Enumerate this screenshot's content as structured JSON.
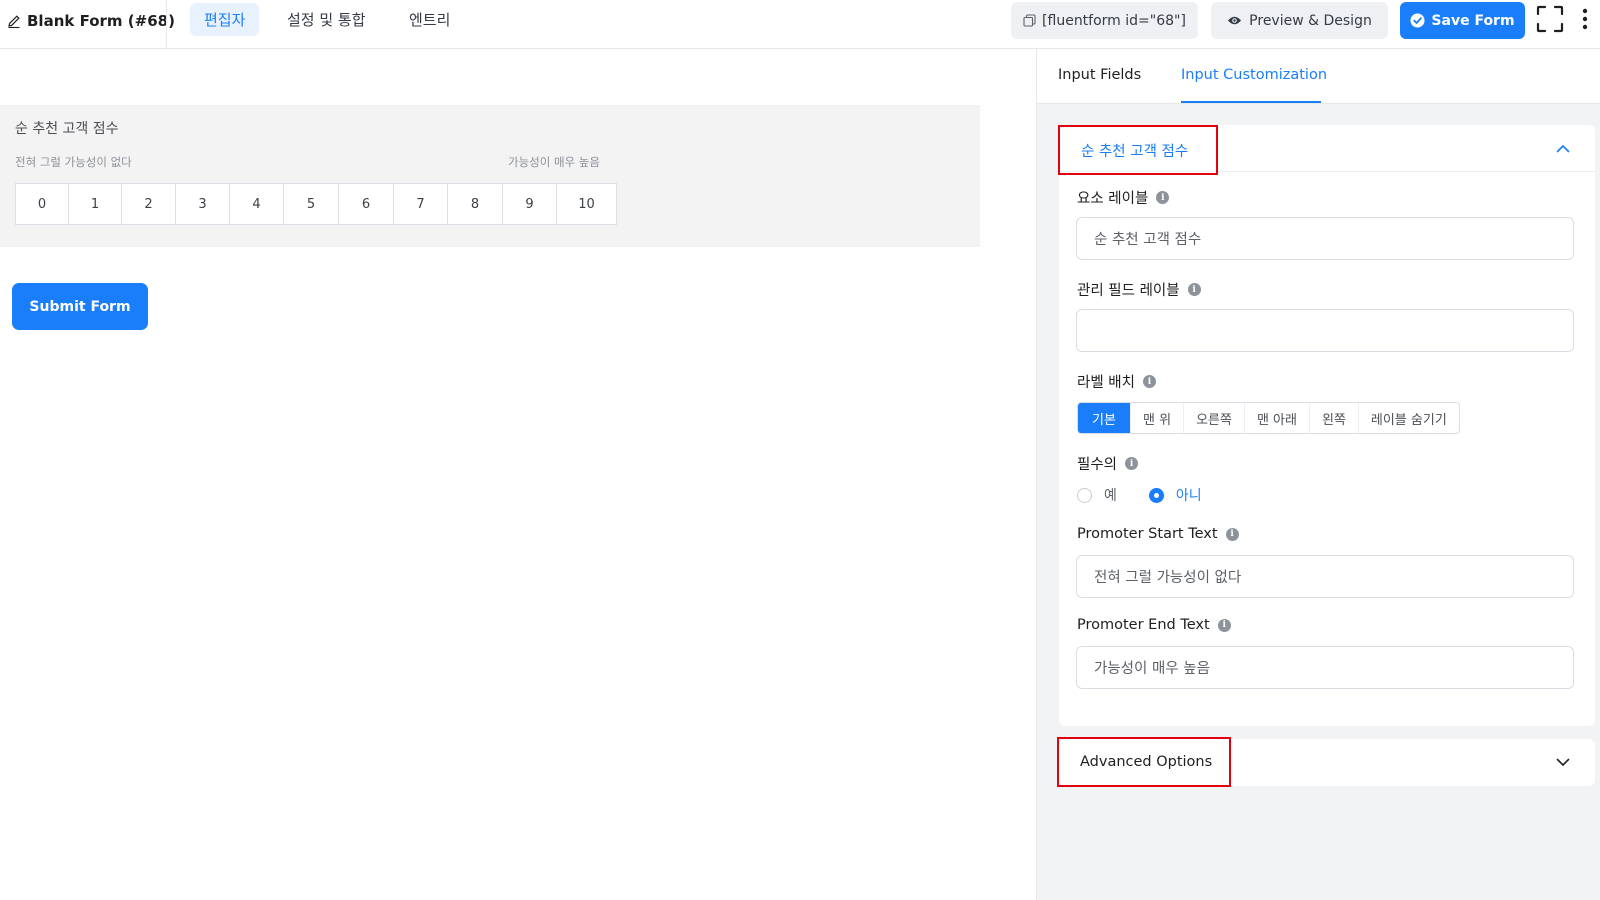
{
  "header": {
    "form_title": "Blank Form (#68)",
    "tabs": [
      {
        "label": "편집자",
        "active": true
      },
      {
        "label": "설정 및 통합",
        "active": false
      },
      {
        "label": "엔트리",
        "active": false
      }
    ],
    "shortcode_label": "[fluentform id=\"68\"]",
    "preview_label": "Preview & Design",
    "save_label": "Save Form"
  },
  "canvas": {
    "field_label": "순 추천 고객 점수",
    "start_text": "전혀 그럴 가능성이 없다",
    "end_text": "가능성이 매우 높음",
    "scale": [
      "0",
      "1",
      "2",
      "3",
      "4",
      "5",
      "6",
      "7",
      "8",
      "9",
      "10"
    ],
    "submit_label": "Submit Form"
  },
  "panel": {
    "tabs": [
      {
        "label": "Input Fields",
        "active": false
      },
      {
        "label": "Input Customization",
        "active": true
      }
    ],
    "section_title": "순 추천 고객 점수",
    "element_label": {
      "label": "요소 레이블",
      "value": "순 추천 고객 점수"
    },
    "admin_label": {
      "label": "관리 필드 레이블",
      "value": ""
    },
    "label_placement": {
      "label": "라벨 배치",
      "options": [
        "기본",
        "맨 위",
        "오른쪽",
        "맨 아래",
        "왼쪽",
        "레이블 숨기기"
      ],
      "selected": "기본"
    },
    "required": {
      "label": "필수의",
      "options": [
        "예",
        "아니"
      ],
      "selected": "아니"
    },
    "promoter_start": {
      "label": "Promoter Start Text",
      "value": "전혀 그럴 가능성이 없다"
    },
    "promoter_end": {
      "label": "Promoter End Text",
      "value": "가능성이 매우 높음"
    },
    "advanced_options": "Advanced Options"
  },
  "colors": {
    "accent": "#1a7efb",
    "highlight_box": "#e3000f",
    "panel_bg": "#f2f3f5",
    "field_bg": "#f3f3f3"
  },
  "icons": [
    "pencil-icon",
    "copy-icon",
    "eye-icon",
    "check-circle-icon",
    "fullscreen-icon",
    "more-vertical-icon",
    "info-icon",
    "chevron-up-icon",
    "chevron-down-icon"
  ]
}
